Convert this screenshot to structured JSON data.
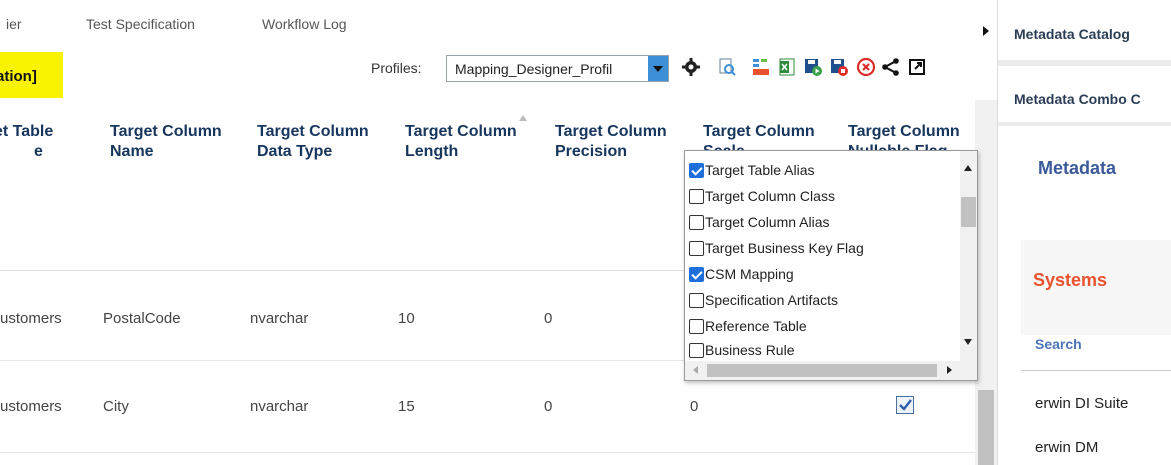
{
  "tabs": [
    "ier",
    "Test Specification",
    "Workflow Log"
  ],
  "title_fragment": "ation]",
  "profiles": {
    "label": "Profiles:",
    "selected": "Mapping_Designer_Profil"
  },
  "toolbar": [
    {
      "name": "settings-gear-icon"
    },
    {
      "name": "preview-document-icon"
    },
    {
      "name": "etl-icon"
    },
    {
      "name": "excel-export-icon"
    },
    {
      "name": "save-run-icon"
    },
    {
      "name": "save-stop-icon"
    },
    {
      "name": "close-circle-icon"
    },
    {
      "name": "share-icon"
    },
    {
      "name": "popout-icon"
    }
  ],
  "columns": [
    {
      "line1": "et Table",
      "line2": "e"
    },
    {
      "line1": "Target Column",
      "line2": "Name"
    },
    {
      "line1": "Target Column",
      "line2": "Data Type"
    },
    {
      "line1": "Target Column",
      "line2": "Length"
    },
    {
      "line1": "Target Column",
      "line2": "Precision"
    },
    {
      "line1": "Target Column",
      "line2": "Scale"
    },
    {
      "line1": "Target Column",
      "line2": "Nullable Flag"
    }
  ],
  "rows": [
    {
      "table": "ustomers",
      "name": "PostalCode",
      "type": "nvarchar",
      "length": "10",
      "precision": "0",
      "scale": "",
      "nullable": null
    },
    {
      "table": "ustomers",
      "name": "City",
      "type": "nvarchar",
      "length": "15",
      "precision": "0",
      "scale": "0",
      "nullable": true
    }
  ],
  "column_chooser": [
    {
      "label": "Target Table Alias",
      "checked": true
    },
    {
      "label": "Target Column Class",
      "checked": false
    },
    {
      "label": "Target Column Alias",
      "checked": false
    },
    {
      "label": "Target Business Key Flag",
      "checked": false
    },
    {
      "label": "CSM Mapping",
      "checked": true
    },
    {
      "label": "Specification Artifacts",
      "checked": false
    },
    {
      "label": "Reference Table",
      "checked": false
    },
    {
      "label": "Business Rule",
      "checked": false
    }
  ],
  "right_panel": {
    "tab1": "Metadata Catalog",
    "tab2": "Metadata Combo C",
    "metadata": "Metadata",
    "systems": "Systems",
    "search": "Search",
    "items": [
      "erwin DI Suite",
      "erwin DM"
    ]
  },
  "colors": {
    "accent": "#1e6fd9",
    "badge": "#f9f200",
    "systems": "#e8532d",
    "header_text": "#17365d"
  }
}
